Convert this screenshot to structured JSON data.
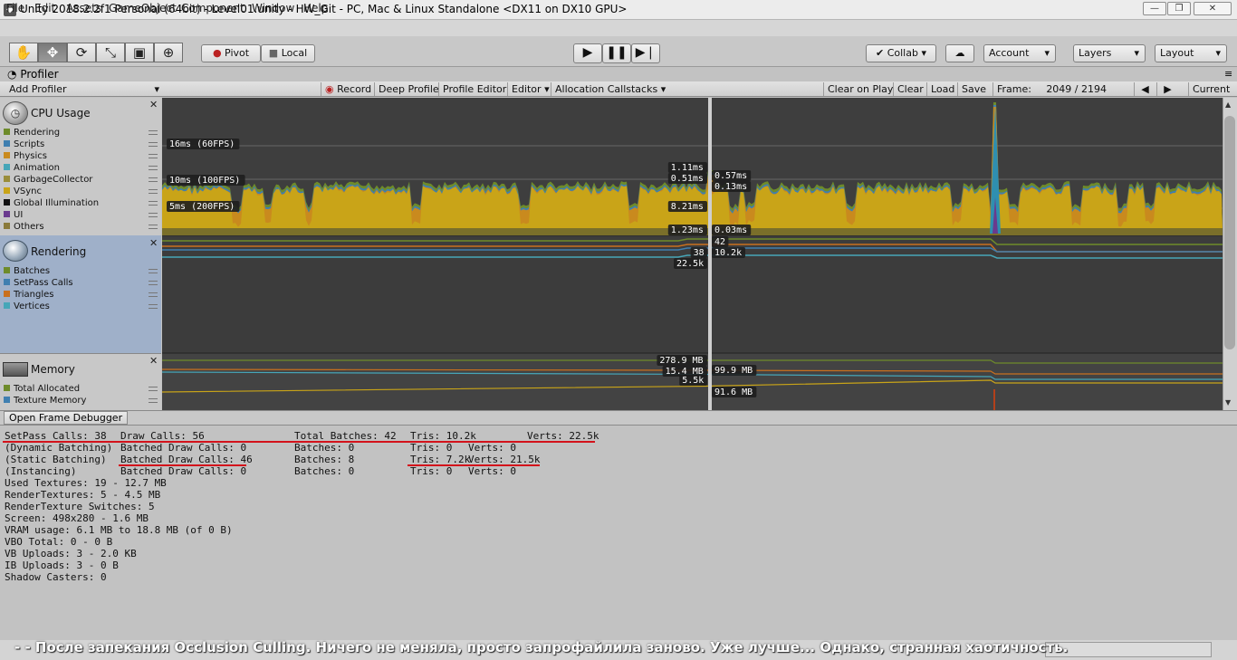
{
  "window": {
    "title": "Unity 2018.2.2f1 Personal (64bit) - Level01.unity - HW_Git - PC, Mac & Linux Standalone <DX11 on DX10 GPU>",
    "minimize": "—",
    "maximize": "❐",
    "close": "✕"
  },
  "menu": [
    "File",
    "Edit",
    "Assets",
    "GameObject",
    "Component",
    "Window",
    "Help"
  ],
  "toolbar": {
    "pivot": "Pivot",
    "local": "Local",
    "collab": "Collab ▾",
    "account": "Account",
    "layers": "Layers",
    "layout": "Layout"
  },
  "profiler": {
    "tab": "Profiler",
    "add_profiler": "Add Profiler",
    "record": "Record",
    "deep_profile": "Deep Profile",
    "profile_editor": "Profile Editor",
    "editor": "Editor",
    "allocation_callstacks": "Allocation Callstacks",
    "clear_on_play": "Clear on Play",
    "clear": "Clear",
    "load": "Load",
    "save": "Save",
    "frame_label": "Frame:",
    "frame_value": "2049 / 2194",
    "current": "Current",
    "open_frame_debugger": "Open Frame Debugger"
  },
  "areas": {
    "cpu": {
      "title": "CPU Usage",
      "legend": [
        {
          "label": "Rendering",
          "color": "#6e8b2a"
        },
        {
          "label": "Scripts",
          "color": "#3f7fb0"
        },
        {
          "label": "Physics",
          "color": "#c98a1e"
        },
        {
          "label": "Animation",
          "color": "#46a6b8"
        },
        {
          "label": "GarbageCollector",
          "color": "#9a8d3a"
        },
        {
          "label": "VSync",
          "color": "#c9a418"
        },
        {
          "label": "Global Illumination",
          "color": "#111111"
        },
        {
          "label": "UI",
          "color": "#6a3a8e"
        },
        {
          "label": "Others",
          "color": "#8a7a3a"
        }
      ]
    },
    "rendering": {
      "title": "Rendering",
      "legend": [
        {
          "label": "Batches",
          "color": "#6e8b2a"
        },
        {
          "label": "SetPass Calls",
          "color": "#3f7fb0"
        },
        {
          "label": "Triangles",
          "color": "#c9701e"
        },
        {
          "label": "Vertices",
          "color": "#46a6b8"
        }
      ]
    },
    "memory": {
      "title": "Memory",
      "legend": [
        {
          "label": "Total Allocated",
          "color": "#6e8b2a"
        },
        {
          "label": "Texture Memory",
          "color": "#3f7fb0"
        }
      ]
    }
  },
  "graph_labels": {
    "fps16": "16ms (60FPS)",
    "fps10": "10ms (100FPS)",
    "fps5": "5ms (200FPS)",
    "cpu_left": [
      "1.11ms",
      "0.51ms",
      "8.21ms",
      "1.23ms"
    ],
    "cpu_right": [
      "0.57ms",
      "0.13ms",
      "0.03ms"
    ],
    "render_right_top": "42",
    "render_left": [
      "38",
      "22.5k"
    ],
    "render_right": "10.2k",
    "mem_left": [
      "278.9 MB",
      "15.4 MB",
      "5.5k"
    ],
    "mem_right": [
      "99.9 MB",
      "91.6 MB"
    ]
  },
  "stats": {
    "row1": [
      "SetPass Calls: 38",
      "Draw Calls: 56",
      "Total Batches: 42",
      "Tris: 10.2k",
      "Verts: 22.5k"
    ],
    "row2": [
      "(Dynamic Batching)",
      "Batched Draw Calls: 0",
      "Batches: 0",
      "Tris: 0",
      "Verts: 0"
    ],
    "row3": [
      "(Static Batching)",
      "Batched Draw Calls: 46",
      "Batches: 8",
      "Tris: 7.2k",
      "Verts: 21.5k"
    ],
    "row4": [
      "(Instancing)",
      "Batched Draw Calls: 0",
      "Batches: 0",
      "Tris: 0",
      "Verts: 0"
    ],
    "lines": [
      "Used Textures: 19 - 12.7 MB",
      "RenderTextures: 5 - 4.5 MB",
      "RenderTexture Switches: 5",
      "Screen: 498x280 - 1.6 MB",
      "VRAM usage: 6.1 MB to 18.8 MB (of 0 B)",
      "VBO Total: 0 - 0 B",
      "VB Uploads: 3 - 2.0 KB",
      "IB Uploads: 3 - 0 B",
      "Shadow Casters: 0"
    ]
  },
  "caption": "- - После запекания Occlusion Culling. Ничего не меняла, просто запрофайлила заново. Уже лучше... Однако, странная хаотичность."
}
